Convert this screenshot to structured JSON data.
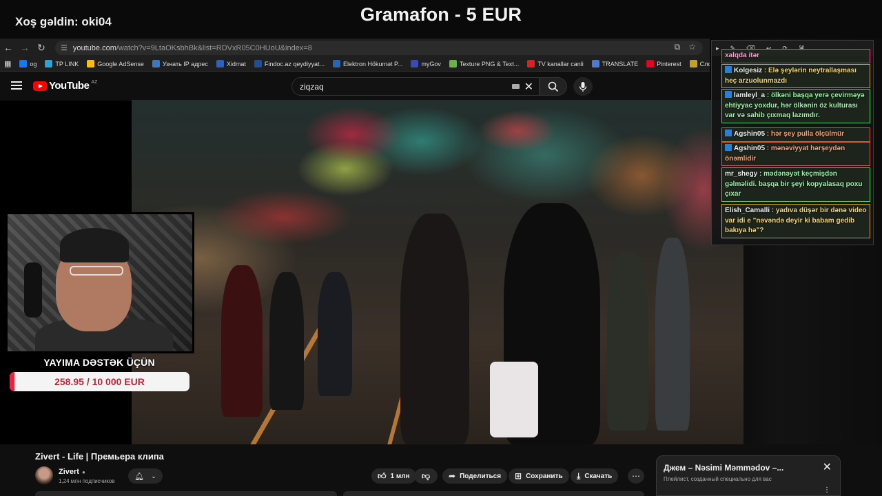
{
  "overlay": {
    "welcome": "Xoş gəldin: oki04",
    "donation_title": "Gramafon - 5 EUR",
    "support_label": "YAYIMA DƏSTƏK ÜÇÜN",
    "support_amount": "258.95 / 10 000 EUR",
    "support_progress": 0.026
  },
  "browser": {
    "url_domain": "youtube.com",
    "url_path": "/watch?v=9LtaOKsbhBk&list=RDVxR05C0HUoU&index=8",
    "bookmarks": [
      {
        "label": "og",
        "color": "#1877f2"
      },
      {
        "label": "TP LINK",
        "color": "#2aa3d8"
      },
      {
        "label": "Google AdSense",
        "color": "#fbbc04"
      },
      {
        "label": "Узнать IP адрес",
        "color": "#3b78c4"
      },
      {
        "label": "Xidmat",
        "color": "#2f5fbf"
      },
      {
        "label": "Findoc.az qeydiyyat...",
        "color": "#1a4fa0"
      },
      {
        "label": "Elektron Hökumət P...",
        "color": "#2466b8"
      },
      {
        "label": "myGov",
        "color": "#3a4ab0"
      },
      {
        "label": "Texture PNG & Text...",
        "color": "#6ab04c"
      },
      {
        "label": "TV kanallar canli",
        "color": "#e02020"
      },
      {
        "label": "TRANSLATE",
        "color": "#4a7ad8"
      },
      {
        "label": "Pinterest",
        "color": "#e60023"
      },
      {
        "label": "Словарь игровых т...",
        "color": "#c8a020"
      }
    ]
  },
  "youtube": {
    "country": "AZ",
    "search_value": "ziqzaq",
    "video_title": "Zivert - Life | Премьера клипа",
    "channel_name": "Zivert",
    "channel_subs": "1,24 млн подписчиков",
    "likes": "1 млн",
    "share_label": "Поделиться",
    "save_label": "Сохранить",
    "download_label": "Скачать",
    "playlist_title": "Джем – Nəsimi Məmmədov –...",
    "playlist_sub": "Плейлист, созданный специально для вас"
  },
  "chat": {
    "messages": [
      {
        "user": "",
        "text": "xalqda itər",
        "style": "m-pink"
      },
      {
        "user": "Kolgesiz",
        "text": "Elə şeylərin neytrallaşması heç arzuolunmazdı",
        "style": "m-yellow"
      },
      {
        "user": "lamleyl_a",
        "text": "ölkəni başqa yerə çevirməyə ehtiyyac yoxdur, hər ölkənin öz kulturası var və sahib çıxmaq lazımdır.",
        "style": "m-green"
      },
      {
        "user": "Agshin05",
        "text": "hər şey pulla ölçülmür",
        "style": "m-orange"
      },
      {
        "user": "Agshin05",
        "text": "mənəviyyat hərşeydən önəmlidir",
        "style": "m-orange"
      },
      {
        "user": "mr_shegy",
        "text": "mədənəyət keçmişdən gəlməlidi. başqa bir şeyi kopyalasaq poxu çıxar",
        "style": "m-green"
      },
      {
        "user": "Elish_Camalli",
        "text": "yadıva düşər bir dənə video var idi e \"nəvəndə deyir ki babam gedib bakıya hə\"?",
        "style": "m-yellow"
      }
    ]
  }
}
